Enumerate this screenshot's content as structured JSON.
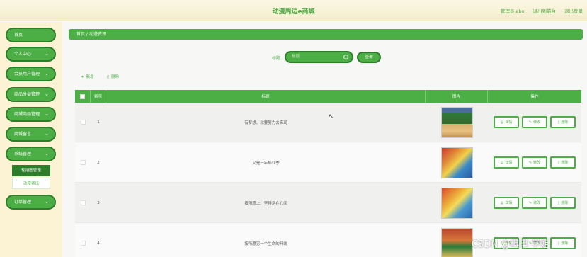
{
  "header": {
    "title": "动漫周边e商城",
    "admin_label": "管理员 abo",
    "back_home": "退出到前台",
    "logout": "退出登录"
  },
  "sidebar": {
    "items": [
      {
        "label": "首页",
        "chevron": ""
      },
      {
        "label": "个人中心",
        "chevron": "⌄"
      },
      {
        "label": "会员用户管理",
        "chevron": "⌄"
      },
      {
        "label": "商品分类管理",
        "chevron": "⌄"
      },
      {
        "label": "商城商品管理",
        "chevron": "⌄"
      },
      {
        "label": "商城留言",
        "chevron": "⌄"
      },
      {
        "label": "系统管理",
        "chevron": "⌄"
      },
      {
        "label": "订单管理",
        "chevron": "⌄"
      }
    ],
    "submenu": [
      "轮播图管理",
      "动漫资讯"
    ]
  },
  "breadcrumb": "首页 / 动漫资讯",
  "search": {
    "label": "标题",
    "placeholder": "标题",
    "button": "查询"
  },
  "actions": {
    "add": "新增",
    "delete": "删除"
  },
  "table": {
    "headers": [
      "索引",
      "标题",
      "图片",
      "操作"
    ],
    "rows": [
      {
        "index": "1",
        "title": "有梦想、就要努力去实现"
      },
      {
        "index": "2",
        "title": "又是一年毕业季"
      },
      {
        "index": "3",
        "title": "按所愿上、坚持常在心间"
      },
      {
        "index": "4",
        "title": "按所愿另一个生命的开端"
      }
    ],
    "op_labels": [
      "详情",
      "修改",
      "删除"
    ]
  },
  "watermark": "CSDN @琪琪 学姐"
}
